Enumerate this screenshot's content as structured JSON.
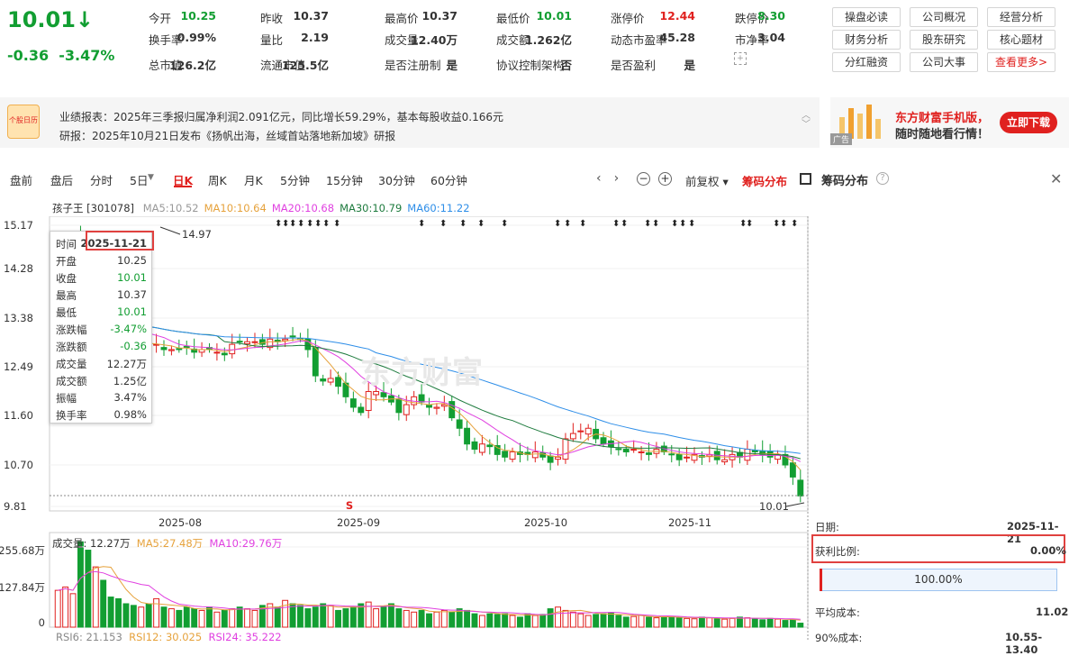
{
  "quote": {
    "price": "10.01",
    "arrow": "↓",
    "change": "-0.36",
    "pct": "-3.47%",
    "fields": [
      [
        "今开",
        "10.25"
      ],
      [
        "昨收",
        "10.37"
      ],
      [
        "最高价",
        "10.37"
      ],
      [
        "最低价",
        "10.01"
      ],
      [
        "涨停价",
        "12.44"
      ],
      [
        "跌停价",
        "8.30"
      ],
      [
        "换手率",
        "0.99%"
      ],
      [
        "量比",
        "2.19"
      ],
      [
        "成交量",
        "12.40万"
      ],
      [
        "成交额",
        "1.262亿"
      ],
      [
        "动态市盈率",
        "45.28"
      ],
      [
        "市净率",
        "3.04"
      ],
      [
        "总市值",
        "126.2亿"
      ],
      [
        "流通市值",
        "125.5亿"
      ],
      [
        "是否注册制",
        "是"
      ],
      [
        "协议控制架构",
        "否"
      ],
      [
        "是否盈利",
        "是"
      ]
    ]
  },
  "buttons": [
    "操盘必读",
    "公司概况",
    "经营分析",
    "财务分析",
    "股东研究",
    "核心题材",
    "分红融资",
    "公司大事",
    "查看更多>"
  ],
  "info": {
    "icon_text": "个股日历",
    "line1": "业绩报表：2025年三季报归属净利润2.091亿元，同比增长59.29%，基本每股收益0.166元",
    "line2": "研报：2025年10月21日发布《扬帆出海，丝域首站落地新加坡》研报"
  },
  "ad": {
    "line1": "东方财富手机版，",
    "line2": "随时随地看行情！",
    "button": "立即下载",
    "tag": "广告"
  },
  "tabs": [
    "盘前",
    "盘后",
    "分时",
    "5日",
    "日K",
    "周K",
    "月K",
    "5分钟",
    "15分钟",
    "30分钟",
    "60分钟"
  ],
  "tools": {
    "adjust": "前复权",
    "chip": "筹码分布",
    "panel_title": "筹码分布"
  },
  "chart": {
    "stock": "孩子王 [301078]",
    "ma": [
      [
        "MA5:10.52",
        "#999"
      ],
      [
        "MA10:10.64",
        "#e6a23c"
      ],
      [
        "MA20:10.68",
        "#e040e0"
      ],
      [
        "MA30:10.79",
        "#1e7b3e"
      ],
      [
        "MA60:11.22",
        "#2e8ee8"
      ]
    ],
    "yticks": [
      "15.17",
      "14.28",
      "13.38",
      "12.49",
      "11.60",
      "10.70",
      "9.81"
    ],
    "xticks": [
      "2025-08",
      "2025-09",
      "2025-10",
      "2025-11"
    ],
    "high_label": "14.97",
    "low_label": "10.01",
    "s_mark": "S",
    "watermark": "东方财富"
  },
  "tooltip": [
    [
      "时间",
      "2025-11-21"
    ],
    [
      "开盘",
      "10.25"
    ],
    [
      "收盘",
      "10.01"
    ],
    [
      "最高",
      "10.37"
    ],
    [
      "最低",
      "10.01"
    ],
    [
      "涨跌幅",
      "-3.47%"
    ],
    [
      "涨跌额",
      "-0.36"
    ],
    [
      "成交量",
      "12.27万"
    ],
    [
      "成交额",
      "1.25亿"
    ],
    [
      "振幅",
      "3.47%"
    ],
    [
      "换手率",
      "0.98%"
    ]
  ],
  "volume": {
    "label": "成交量: 12.27万",
    "ma5": "MA5:27.48万",
    "ma10": "MA10:29.76万",
    "yticks": [
      "255.68万",
      "127.84万",
      "0"
    ]
  },
  "rsi": {
    "r6": "RSI6: 21.153",
    "r12": "RSI12: 30.025",
    "r24": "RSI24: 35.222"
  },
  "chip": {
    "yticks": [
      "15.17",
      "14.28",
      "13.38",
      "12.49",
      "11.60",
      "11.02",
      "10.70",
      "9.81"
    ],
    "date_lbl": "日期:",
    "date": "2025-11-21",
    "profit_lbl": "获利比例:",
    "profit": "0.00%",
    "bar": "100.00%",
    "avg_lbl": "平均成本:",
    "avg": "11.02",
    "c90_lbl": "90%成本:",
    "c90": "10.55-13.40"
  },
  "colors": {
    "up": "#e0211f",
    "down": "#129e32"
  }
}
